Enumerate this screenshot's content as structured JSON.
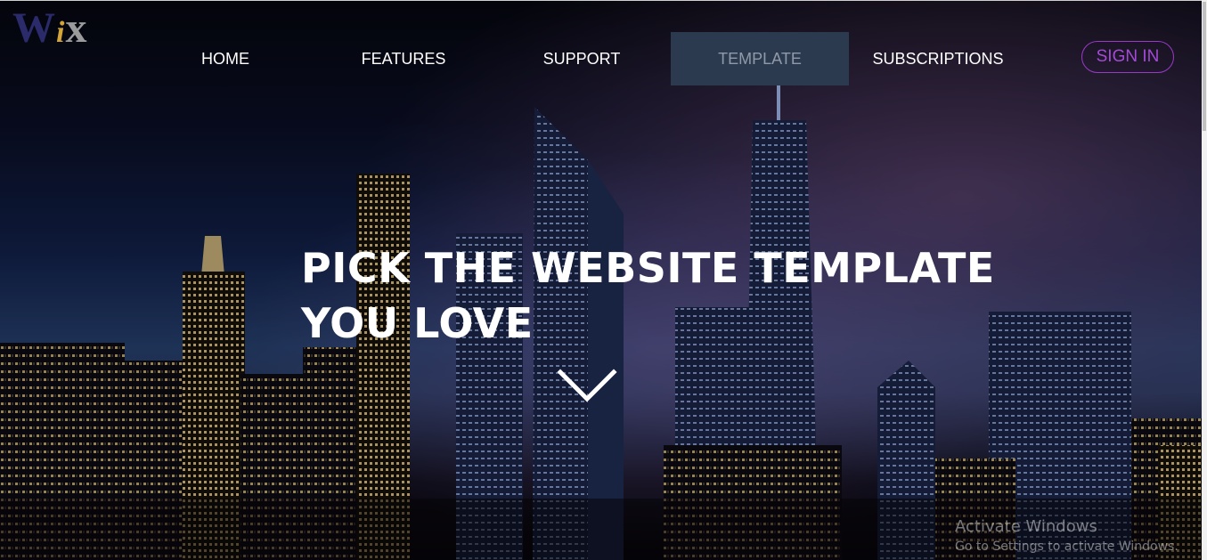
{
  "logo": {
    "letters": [
      "W",
      "i",
      "x"
    ]
  },
  "nav": {
    "items": [
      {
        "label": "HOME",
        "active": false
      },
      {
        "label": "FEATURES",
        "active": false
      },
      {
        "label": "SUPPORT",
        "active": false
      },
      {
        "label": "TEMPLATE",
        "active": true
      },
      {
        "label": "SUBSCRIPTIONS",
        "active": false
      }
    ],
    "signin_label": "SIGN IN"
  },
  "hero": {
    "headline_line1": "PICK THE WEBSITE TEMPLATE",
    "headline_line2": "YOU LOVE",
    "scroll_icon": "chevron-down-icon"
  },
  "watermark": {
    "title": "Activate Windows",
    "subtitle": "Go to Settings to activate Windows."
  },
  "colors": {
    "nav_active_bg": "#2c3a50",
    "nav_active_text": "#8f99a8",
    "signin_accent": "#9b38c9",
    "logo_w": "#2b2a6a",
    "logo_i": "#d4a53a",
    "logo_x": "#9b9b9b"
  }
}
